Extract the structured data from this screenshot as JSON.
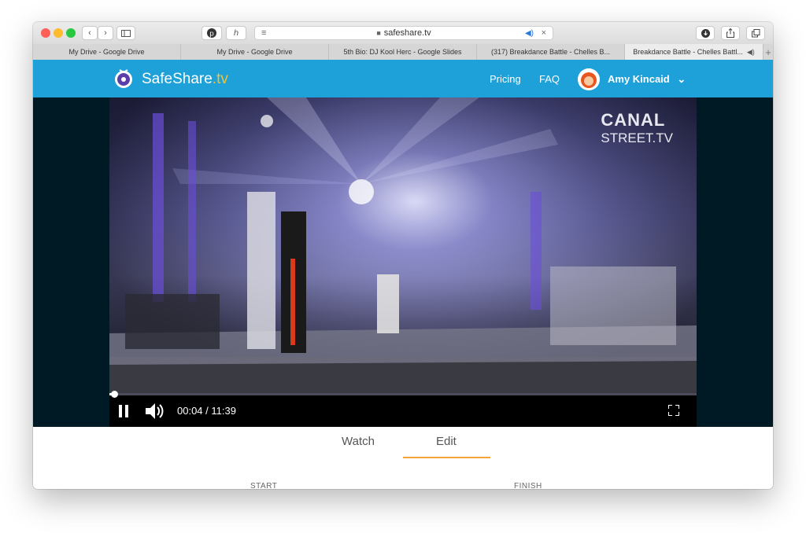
{
  "browser": {
    "url": "safeshare.tv",
    "tabs": [
      {
        "label": "My Drive - Google Drive"
      },
      {
        "label": "My Drive - Google Drive"
      },
      {
        "label": "5th Bio: DJ Kool Herc - Google Slides"
      },
      {
        "label": "(317) Breakdance Battle - Chelles B..."
      },
      {
        "label": "Breakdance Battle - Chelles Battl..."
      }
    ]
  },
  "header": {
    "logo_text": "SafeShare",
    "logo_suffix": ".tv",
    "nav": [
      "Pricing",
      "FAQ"
    ],
    "user_name": "Amy Kincaid"
  },
  "video": {
    "watermark_line1": "CANAL",
    "watermark_line2": "STREET.TV",
    "time": "00:04 / 11:39",
    "progress": 0.006
  },
  "tabs": [
    {
      "label": "Watch"
    },
    {
      "label": "Edit"
    }
  ],
  "labels": {
    "start": "START",
    "finish": "FINISH"
  },
  "colors": {
    "brand": "#1ea0d9",
    "accent": "#f3a63a",
    "video_bg": "#001a25"
  }
}
